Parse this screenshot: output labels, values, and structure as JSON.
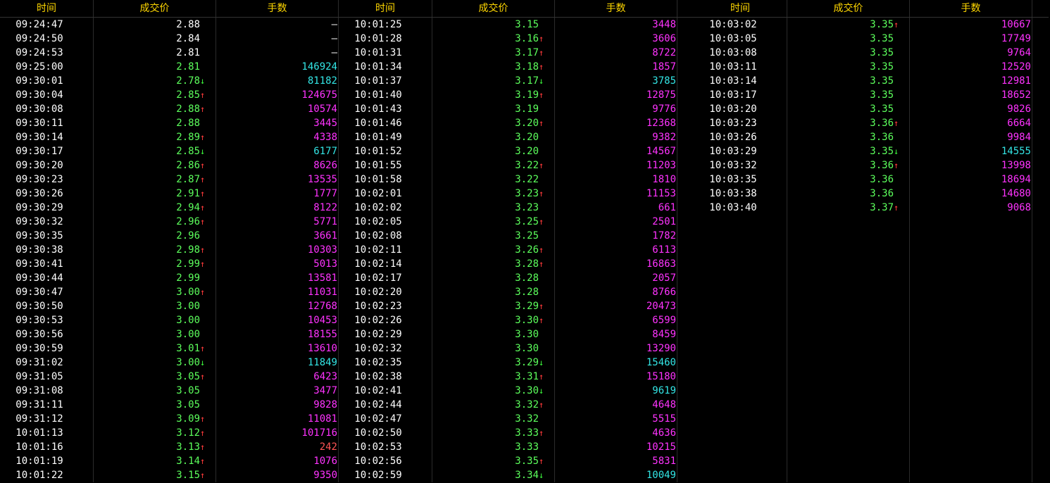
{
  "colors": {
    "background": "#000000",
    "header_text": "#ffd700",
    "time_text": "#ffffff",
    "price_white": "#ffffff",
    "price_green": "#5cff5c",
    "vol_magenta": "#ff33ff",
    "vol_cyan": "#33e6e6",
    "vol_red": "#ff5555",
    "vol_white": "#ffffff",
    "arrow_up": "#ff3b3b",
    "arrow_down": "#3cf83c"
  },
  "headers": {
    "time": "时间",
    "price": "成交价",
    "volume": "手数"
  },
  "columns": [
    [
      {
        "t": "09:24:47",
        "p": "2.88",
        "a": "",
        "pc": "w",
        "v": "—",
        "vc": "w"
      },
      {
        "t": "09:24:50",
        "p": "2.84",
        "a": "",
        "pc": "w",
        "v": "—",
        "vc": "w"
      },
      {
        "t": "09:24:53",
        "p": "2.81",
        "a": "",
        "pc": "w",
        "v": "—",
        "vc": "w"
      },
      {
        "t": "09:25:00",
        "p": "2.81",
        "a": "",
        "pc": "g",
        "v": "146924",
        "vc": "c"
      },
      {
        "t": "09:30:01",
        "p": "2.78",
        "a": "down",
        "pc": "g",
        "v": "81182",
        "vc": "c"
      },
      {
        "t": "09:30:04",
        "p": "2.85",
        "a": "up",
        "pc": "g",
        "v": "124675",
        "vc": "m"
      },
      {
        "t": "09:30:08",
        "p": "2.88",
        "a": "up",
        "pc": "g",
        "v": "10574",
        "vc": "m"
      },
      {
        "t": "09:30:11",
        "p": "2.88",
        "a": "",
        "pc": "g",
        "v": "3445",
        "vc": "m"
      },
      {
        "t": "09:30:14",
        "p": "2.89",
        "a": "up",
        "pc": "g",
        "v": "4338",
        "vc": "m"
      },
      {
        "t": "09:30:17",
        "p": "2.85",
        "a": "down",
        "pc": "g",
        "v": "6177",
        "vc": "c"
      },
      {
        "t": "09:30:20",
        "p": "2.86",
        "a": "up",
        "pc": "g",
        "v": "8626",
        "vc": "m"
      },
      {
        "t": "09:30:23",
        "p": "2.87",
        "a": "up",
        "pc": "g",
        "v": "13535",
        "vc": "m"
      },
      {
        "t": "09:30:26",
        "p": "2.91",
        "a": "up",
        "pc": "g",
        "v": "1777",
        "vc": "m"
      },
      {
        "t": "09:30:29",
        "p": "2.94",
        "a": "up",
        "pc": "g",
        "v": "8122",
        "vc": "m"
      },
      {
        "t": "09:30:32",
        "p": "2.96",
        "a": "up",
        "pc": "g",
        "v": "5771",
        "vc": "m"
      },
      {
        "t": "09:30:35",
        "p": "2.96",
        "a": "",
        "pc": "g",
        "v": "3661",
        "vc": "m"
      },
      {
        "t": "09:30:38",
        "p": "2.98",
        "a": "up",
        "pc": "g",
        "v": "10303",
        "vc": "m"
      },
      {
        "t": "09:30:41",
        "p": "2.99",
        "a": "up",
        "pc": "g",
        "v": "5013",
        "vc": "m"
      },
      {
        "t": "09:30:44",
        "p": "2.99",
        "a": "",
        "pc": "g",
        "v": "13581",
        "vc": "m"
      },
      {
        "t": "09:30:47",
        "p": "3.00",
        "a": "up",
        "pc": "g",
        "v": "11031",
        "vc": "m"
      },
      {
        "t": "09:30:50",
        "p": "3.00",
        "a": "",
        "pc": "g",
        "v": "12768",
        "vc": "m"
      },
      {
        "t": "09:30:53",
        "p": "3.00",
        "a": "",
        "pc": "g",
        "v": "10453",
        "vc": "m"
      },
      {
        "t": "09:30:56",
        "p": "3.00",
        "a": "",
        "pc": "g",
        "v": "18155",
        "vc": "m"
      },
      {
        "t": "09:30:59",
        "p": "3.01",
        "a": "up",
        "pc": "g",
        "v": "13610",
        "vc": "m"
      },
      {
        "t": "09:31:02",
        "p": "3.00",
        "a": "down",
        "pc": "g",
        "v": "11849",
        "vc": "c"
      },
      {
        "t": "09:31:05",
        "p": "3.05",
        "a": "up",
        "pc": "g",
        "v": "6423",
        "vc": "m"
      },
      {
        "t": "09:31:08",
        "p": "3.05",
        "a": "",
        "pc": "g",
        "v": "3477",
        "vc": "m"
      },
      {
        "t": "09:31:11",
        "p": "3.05",
        "a": "",
        "pc": "g",
        "v": "9828",
        "vc": "m"
      },
      {
        "t": "09:31:12",
        "p": "3.09",
        "a": "up",
        "pc": "g",
        "v": "11081",
        "vc": "m"
      },
      {
        "t": "10:01:13",
        "p": "3.12",
        "a": "up",
        "pc": "g",
        "v": "101716",
        "vc": "m"
      },
      {
        "t": "10:01:16",
        "p": "3.13",
        "a": "up",
        "pc": "g",
        "v": "242",
        "vc": "r"
      },
      {
        "t": "10:01:19",
        "p": "3.14",
        "a": "up",
        "pc": "g",
        "v": "1076",
        "vc": "m"
      },
      {
        "t": "10:01:22",
        "p": "3.15",
        "a": "up",
        "pc": "g",
        "v": "9350",
        "vc": "m"
      }
    ],
    [
      {
        "t": "10:01:25",
        "p": "3.15",
        "a": "",
        "pc": "g",
        "v": "3448",
        "vc": "m"
      },
      {
        "t": "10:01:28",
        "p": "3.16",
        "a": "up",
        "pc": "g",
        "v": "3606",
        "vc": "m"
      },
      {
        "t": "10:01:31",
        "p": "3.17",
        "a": "up",
        "pc": "g",
        "v": "8722",
        "vc": "m"
      },
      {
        "t": "10:01:34",
        "p": "3.18",
        "a": "up",
        "pc": "g",
        "v": "1857",
        "vc": "m"
      },
      {
        "t": "10:01:37",
        "p": "3.17",
        "a": "down",
        "pc": "g",
        "v": "3785",
        "vc": "c"
      },
      {
        "t": "10:01:40",
        "p": "3.19",
        "a": "up",
        "pc": "g",
        "v": "12875",
        "vc": "m"
      },
      {
        "t": "10:01:43",
        "p": "3.19",
        "a": "",
        "pc": "g",
        "v": "9776",
        "vc": "m"
      },
      {
        "t": "10:01:46",
        "p": "3.20",
        "a": "up",
        "pc": "g",
        "v": "12368",
        "vc": "m"
      },
      {
        "t": "10:01:49",
        "p": "3.20",
        "a": "",
        "pc": "g",
        "v": "9382",
        "vc": "m"
      },
      {
        "t": "10:01:52",
        "p": "3.20",
        "a": "",
        "pc": "g",
        "v": "14567",
        "vc": "m"
      },
      {
        "t": "10:01:55",
        "p": "3.22",
        "a": "up",
        "pc": "g",
        "v": "11203",
        "vc": "m"
      },
      {
        "t": "10:01:58",
        "p": "3.22",
        "a": "",
        "pc": "g",
        "v": "1810",
        "vc": "m"
      },
      {
        "t": "10:02:01",
        "p": "3.23",
        "a": "up",
        "pc": "g",
        "v": "11153",
        "vc": "m"
      },
      {
        "t": "10:02:02",
        "p": "3.23",
        "a": "",
        "pc": "g",
        "v": "661",
        "vc": "m"
      },
      {
        "t": "10:02:05",
        "p": "3.25",
        "a": "up",
        "pc": "g",
        "v": "2501",
        "vc": "m"
      },
      {
        "t": "10:02:08",
        "p": "3.25",
        "a": "",
        "pc": "g",
        "v": "1782",
        "vc": "m"
      },
      {
        "t": "10:02:11",
        "p": "3.26",
        "a": "up",
        "pc": "g",
        "v": "6113",
        "vc": "m"
      },
      {
        "t": "10:02:14",
        "p": "3.28",
        "a": "up",
        "pc": "g",
        "v": "16863",
        "vc": "m"
      },
      {
        "t": "10:02:17",
        "p": "3.28",
        "a": "",
        "pc": "g",
        "v": "2057",
        "vc": "m"
      },
      {
        "t": "10:02:20",
        "p": "3.28",
        "a": "",
        "pc": "g",
        "v": "8766",
        "vc": "m"
      },
      {
        "t": "10:02:23",
        "p": "3.29",
        "a": "up",
        "pc": "g",
        "v": "20473",
        "vc": "m"
      },
      {
        "t": "10:02:26",
        "p": "3.30",
        "a": "up",
        "pc": "g",
        "v": "6599",
        "vc": "m"
      },
      {
        "t": "10:02:29",
        "p": "3.30",
        "a": "",
        "pc": "g",
        "v": "8459",
        "vc": "m"
      },
      {
        "t": "10:02:32",
        "p": "3.30",
        "a": "",
        "pc": "g",
        "v": "13290",
        "vc": "m"
      },
      {
        "t": "10:02:35",
        "p": "3.29",
        "a": "down",
        "pc": "g",
        "v": "15460",
        "vc": "c"
      },
      {
        "t": "10:02:38",
        "p": "3.31",
        "a": "up",
        "pc": "g",
        "v": "15180",
        "vc": "m"
      },
      {
        "t": "10:02:41",
        "p": "3.30",
        "a": "down",
        "pc": "g",
        "v": "9619",
        "vc": "c"
      },
      {
        "t": "10:02:44",
        "p": "3.32",
        "a": "up",
        "pc": "g",
        "v": "4648",
        "vc": "m"
      },
      {
        "t": "10:02:47",
        "p": "3.32",
        "a": "",
        "pc": "g",
        "v": "5515",
        "vc": "m"
      },
      {
        "t": "10:02:50",
        "p": "3.33",
        "a": "up",
        "pc": "g",
        "v": "4636",
        "vc": "m"
      },
      {
        "t": "10:02:53",
        "p": "3.33",
        "a": "",
        "pc": "g",
        "v": "10215",
        "vc": "m"
      },
      {
        "t": "10:02:56",
        "p": "3.35",
        "a": "up",
        "pc": "g",
        "v": "5831",
        "vc": "m"
      },
      {
        "t": "10:02:59",
        "p": "3.34",
        "a": "down",
        "pc": "g",
        "v": "10049",
        "vc": "c"
      }
    ],
    [
      {
        "t": "10:03:02",
        "p": "3.35",
        "a": "up",
        "pc": "g",
        "v": "10667",
        "vc": "m"
      },
      {
        "t": "10:03:05",
        "p": "3.35",
        "a": "",
        "pc": "g",
        "v": "17749",
        "vc": "m"
      },
      {
        "t": "10:03:08",
        "p": "3.35",
        "a": "",
        "pc": "g",
        "v": "9764",
        "vc": "m"
      },
      {
        "t": "10:03:11",
        "p": "3.35",
        "a": "",
        "pc": "g",
        "v": "12520",
        "vc": "m"
      },
      {
        "t": "10:03:14",
        "p": "3.35",
        "a": "",
        "pc": "g",
        "v": "12981",
        "vc": "m"
      },
      {
        "t": "10:03:17",
        "p": "3.35",
        "a": "",
        "pc": "g",
        "v": "18652",
        "vc": "m"
      },
      {
        "t": "10:03:20",
        "p": "3.35",
        "a": "",
        "pc": "g",
        "v": "9826",
        "vc": "m"
      },
      {
        "t": "10:03:23",
        "p": "3.36",
        "a": "up",
        "pc": "g",
        "v": "6664",
        "vc": "m"
      },
      {
        "t": "10:03:26",
        "p": "3.36",
        "a": "",
        "pc": "g",
        "v": "9984",
        "vc": "m"
      },
      {
        "t": "10:03:29",
        "p": "3.35",
        "a": "down",
        "pc": "g",
        "v": "14555",
        "vc": "c"
      },
      {
        "t": "10:03:32",
        "p": "3.36",
        "a": "up",
        "pc": "g",
        "v": "13998",
        "vc": "m"
      },
      {
        "t": "10:03:35",
        "p": "3.36",
        "a": "",
        "pc": "g",
        "v": "18694",
        "vc": "m"
      },
      {
        "t": "10:03:38",
        "p": "3.36",
        "a": "",
        "pc": "g",
        "v": "14680",
        "vc": "m"
      },
      {
        "t": "10:03:40",
        "p": "3.37",
        "a": "up",
        "pc": "g",
        "v": "9068",
        "vc": "m"
      }
    ]
  ]
}
